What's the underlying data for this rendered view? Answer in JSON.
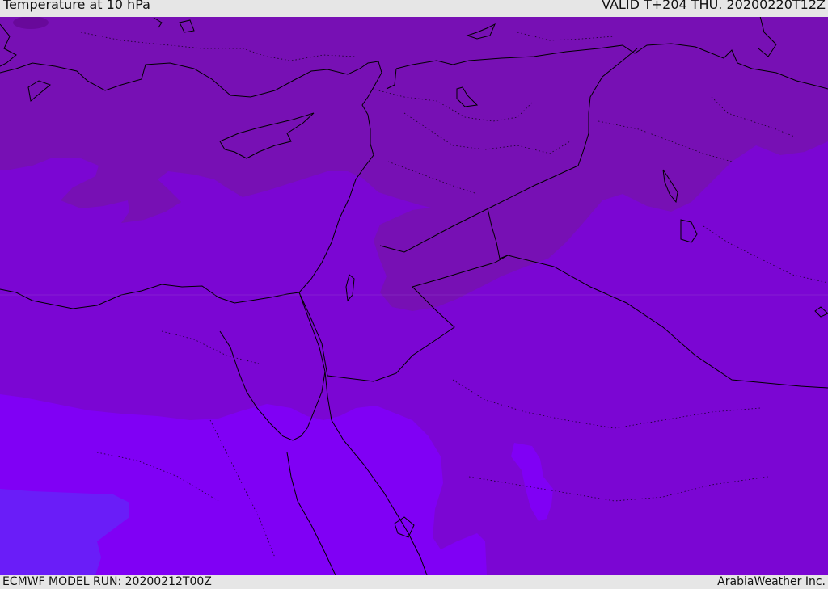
{
  "header": {
    "title": "Temperature at 10 hPa",
    "valid": "VALID T+204 THU. 20200220T12Z"
  },
  "footer": {
    "model_run": "ECMWF MODEL RUN: 20200212T00Z",
    "credit": "ArabiaWeather Inc."
  },
  "colors": {
    "band_coldest": "#68099a",
    "band_cold": "#7710b4",
    "band_mid": "#7b06d3",
    "band_warm": "#8000f5",
    "band_warmest": "#6a1df8",
    "coastline": "#000000"
  }
}
